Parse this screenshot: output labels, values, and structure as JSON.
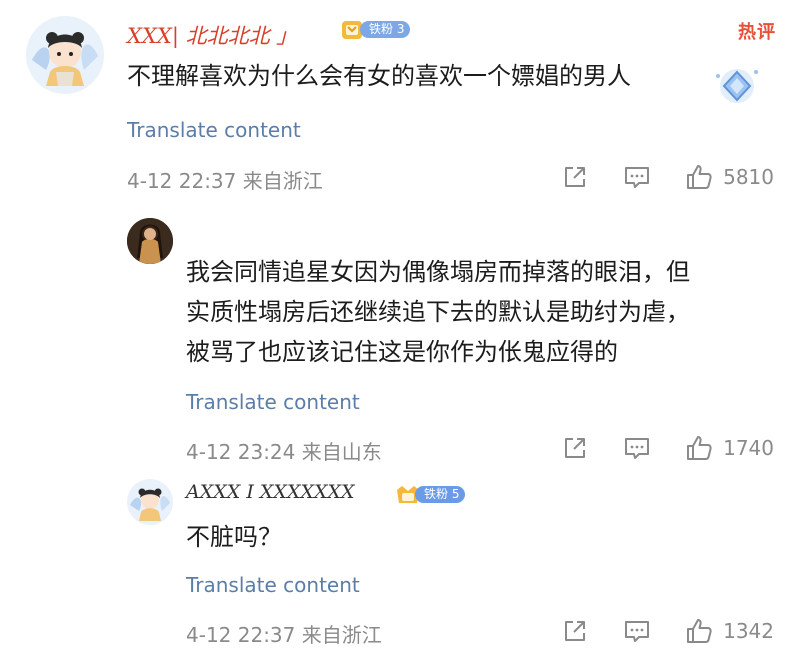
{
  "hot_label": "热评",
  "comments": [
    {
      "username": "XXX| 北北北北 」",
      "badge": "铁粉 3",
      "badge_color": "#7ea7e6",
      "text_lines": [
        "不理解喜欢为什么会有女的喜欢一个嫖娼的男人"
      ],
      "translate": "Translate content",
      "meta": "4-12 22:37 来自浙江",
      "likes": "5810"
    },
    {
      "username": "",
      "badge": "",
      "text_lines": [
        "我会同情追星女因为偶像塌房而掉落的眼泪，但",
        "实质性塌房后还继续追下去的默认是助纣为虐，",
        "被骂了也应该记住这是你作为伥鬼应得的"
      ],
      "translate": "Translate content",
      "meta": "4-12 23:24 来自山东",
      "likes": "1740"
    },
    {
      "username": "AXXX I XXXXXXX",
      "badge": "铁粉 5",
      "badge_color": "#6b9be8",
      "text_lines": [
        "不脏吗？"
      ],
      "translate": "Translate content",
      "meta": "4-12 22:37 来自浙江",
      "likes": "1342"
    }
  ],
  "icons": {
    "share": "share-icon",
    "comment": "comment-icon",
    "like": "thumbs-up-icon"
  },
  "colors": {
    "username_red": "#d8402c",
    "link_blue": "#5b7ea8",
    "meta_gray": "#8a8a8a",
    "hot_red": "#e8503a"
  }
}
